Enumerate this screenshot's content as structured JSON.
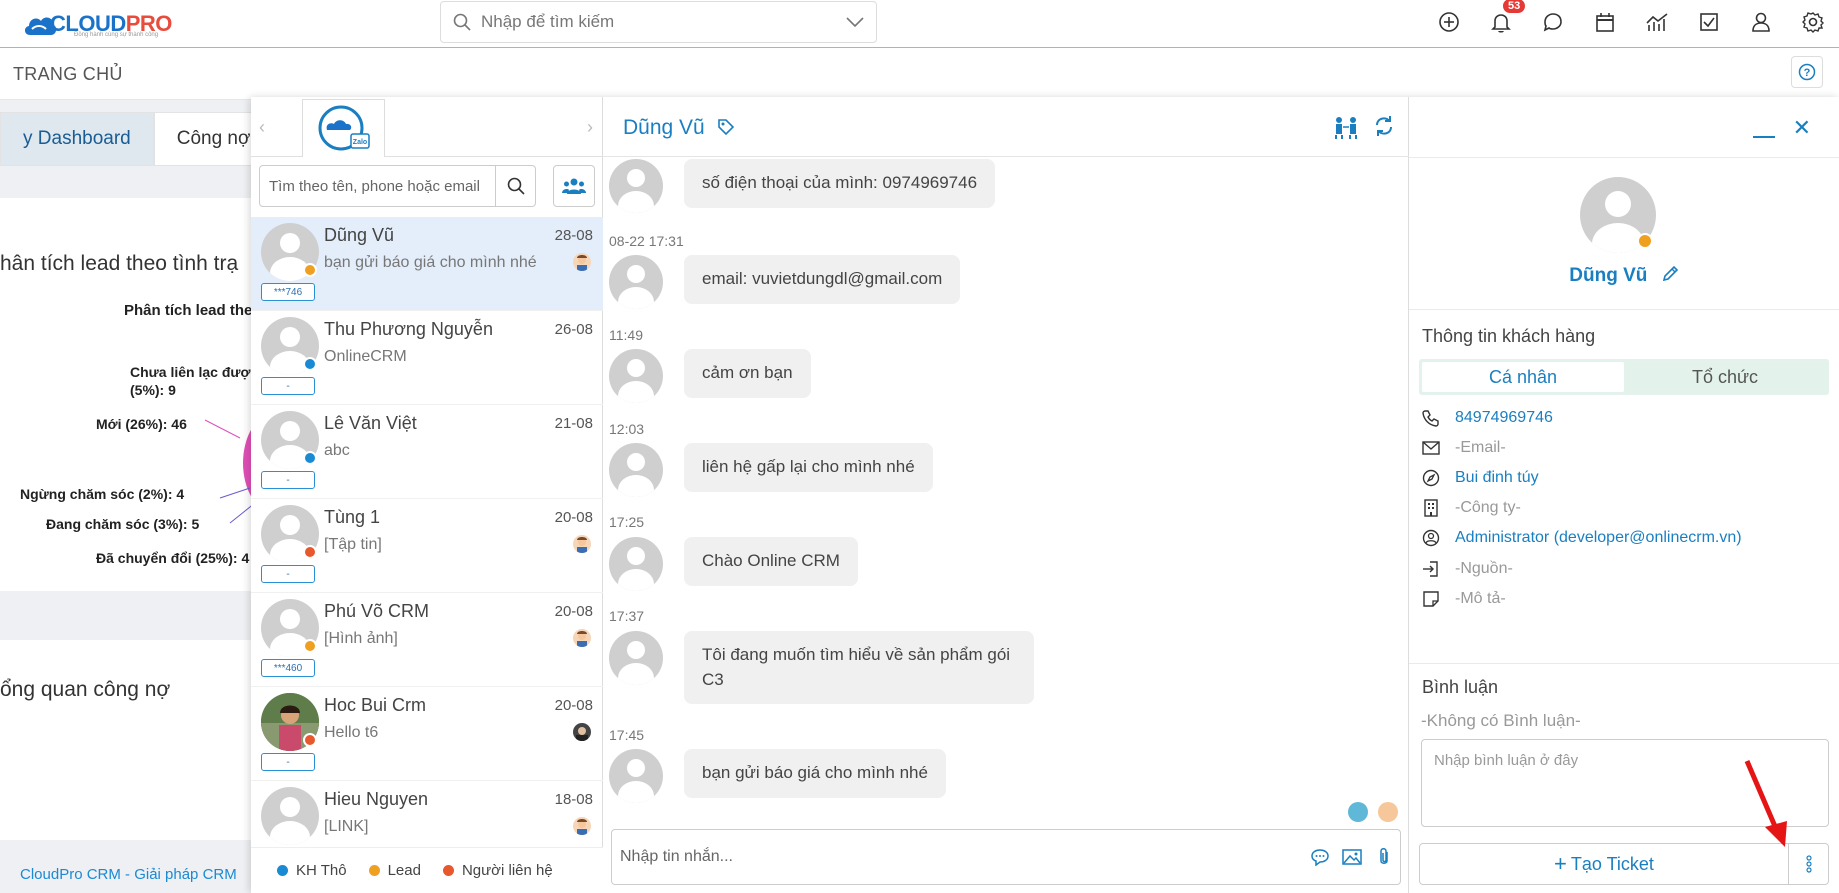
{
  "app": {
    "logo_text_a": "CLOUD",
    "logo_text_b": "PRO",
    "logo_sub": "Đồng hành cùng sự thành công",
    "search_placeholder": "Nhập để tìm kiếm",
    "notification_count": "53",
    "icons": [
      "plus-circle-icon",
      "bell-icon",
      "chat-icon",
      "calendar-icon",
      "chart-icon",
      "checkbox-icon",
      "user-icon",
      "gear-icon"
    ]
  },
  "page": {
    "title": "TRANG CHỦ"
  },
  "dashboard": {
    "tabs": [
      "y Dashboard",
      "Công nợ"
    ],
    "lead_card_title": "hân tích lead theo tình trạ",
    "lead_chart_title": "Phân tích lead the",
    "lead_labels": [
      "Chưa liên lạc đượ",
      "(5%): 9",
      "Mới (26%): 46",
      "Ngừng chăm sóc (2%): 4",
      "Đang chăm sóc (3%): 5",
      "Đã chuyển đổi (25%): 4"
    ],
    "debt_card_title": "ổng quan công nợ",
    "footer_text": "CloudPro CRM - Giải pháp CRM"
  },
  "chat_list": {
    "logo_label": "Zalo",
    "search_placeholder": "Tìm theo tên, phone hoặc email",
    "contacts": [
      {
        "name": "Dũng Vũ",
        "date": "28-08",
        "message": "bạn gửi báo giá cho mình nhé",
        "tag": "***746",
        "status_color": "#f0a020",
        "active": true
      },
      {
        "name": "Thu Phương Nguyễn",
        "date": "26-08",
        "message": "OnlineCRM",
        "tag": "-",
        "status_color": "#1a8ad4"
      },
      {
        "name": "Lê Văn Việt",
        "date": "21-08",
        "message": "abc",
        "tag": "-",
        "status_color": "#1a8ad4"
      },
      {
        "name": "Tùng 1",
        "date": "20-08",
        "message": "[Tập tin]",
        "tag": "-",
        "status_color": "#e8582c"
      },
      {
        "name": "Phú Võ CRM",
        "date": "20-08",
        "message": "[Hình ảnh]",
        "tag": "***460",
        "status_color": "#f0a020"
      },
      {
        "name": "Hoc Bui Crm",
        "date": "20-08",
        "message": "Hello t6",
        "tag": "-",
        "status_color": "#e8582c"
      },
      {
        "name": "Hieu Nguyen",
        "date": "18-08",
        "message": "[LINK]",
        "tag": "",
        "status_color": "#e8582c"
      }
    ],
    "legend": [
      {
        "label": "KH Thô",
        "color": "#1a8ad4"
      },
      {
        "label": "Lead",
        "color": "#f0a020"
      },
      {
        "label": "Người liên hệ",
        "color": "#e8582c"
      }
    ]
  },
  "chat": {
    "contact_name": "Dũng Vũ",
    "messages": [
      {
        "time": "",
        "text": "số điện thoại của mình: 0974969746"
      },
      {
        "time": "08-22 17:31",
        "text": "email: vuvietdungdl@gmail.com"
      },
      {
        "time": "11:49",
        "text": "cảm ơn bạn"
      },
      {
        "time": "12:03",
        "text": "liên hệ gấp lại cho mình nhé"
      },
      {
        "time": "17:25",
        "text": "Chào Online CRM"
      },
      {
        "time": "17:37",
        "text": "Tôi đang muốn tìm hiểu về sản phẩm gói C3"
      },
      {
        "time": "17:45",
        "text": "bạn gửi báo giá cho mình nhé"
      }
    ],
    "input_placeholder": "Nhập tin nhắn..."
  },
  "info": {
    "name": "Dũng Vũ",
    "section_title": "Thông tin khách hàng",
    "segments": [
      "Cá nhân",
      "Tổ chức"
    ],
    "phone": "84974969746",
    "email": "-Email-",
    "address": "Bui đinh túy",
    "company": "-Công ty-",
    "owner": "Administrator (developer@onlinecrm.vn)",
    "source": "-Nguồn-",
    "description": "-Mô tả-",
    "comment_title": "Bình luận",
    "no_comment": "-Không có Bình luận-",
    "comment_placeholder": "Nhập bình luận ở đây",
    "ticket_button": "Tạo Ticket"
  }
}
